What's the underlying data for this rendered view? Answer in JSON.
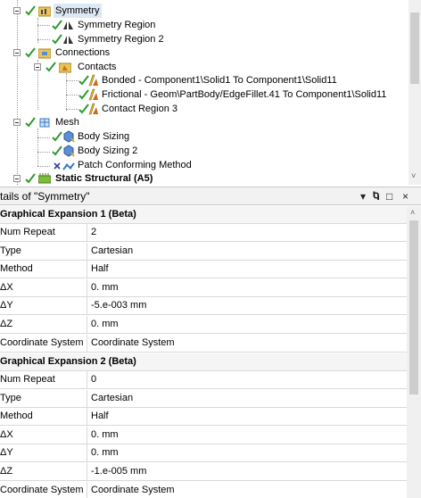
{
  "tree": {
    "items": [
      {
        "label": "Symmetry",
        "state": "highlight",
        "icon": "symmetry-folder-icon"
      },
      {
        "label": "Symmetry Region",
        "icon": "symmetry-region-icon"
      },
      {
        "label": "Symmetry Region 2",
        "icon": "symmetry-region-icon"
      },
      {
        "label": "Connections",
        "icon": "connections-icon"
      },
      {
        "label": "Contacts",
        "icon": "contacts-folder-icon"
      },
      {
        "label": "Bonded - Component1\\Solid1 To Component1\\Solid11",
        "icon": "contact-region-icon"
      },
      {
        "label": "Frictional - Geom\\PartBody/EdgeFillet.41 To Component1\\Solid11",
        "icon": "contact-region-icon"
      },
      {
        "label": "Contact Region 3",
        "icon": "contact-region-icon"
      },
      {
        "label": "Mesh",
        "icon": "mesh-icon"
      },
      {
        "label": "Body Sizing",
        "icon": "body-sizing-icon"
      },
      {
        "label": "Body Sizing 2",
        "icon": "body-sizing-icon"
      },
      {
        "label": "Patch Conforming Method",
        "icon": "patch-conforming-icon"
      },
      {
        "label": "Static Structural (A5)",
        "state": "bold",
        "icon": "static-structural-icon"
      }
    ]
  },
  "details": {
    "title": "tails of \"Symmetry\"",
    "controls": [
      "▾",
      "ᐅ",
      "□",
      "×"
    ]
  },
  "grid": {
    "rows": [
      {
        "type": "group",
        "label": "Graphical Expansion 1 (Beta)"
      },
      {
        "label": "Num Repeat",
        "value": "2"
      },
      {
        "label": "Type",
        "value": "Cartesian"
      },
      {
        "label": "Method",
        "value": "Half"
      },
      {
        "label": "ΔX",
        "value": "0. mm"
      },
      {
        "label": "ΔY",
        "value": "-5.e-003 mm"
      },
      {
        "label": "ΔZ",
        "value": "0. mm"
      },
      {
        "label": "Coordinate System",
        "value": "Coordinate System"
      },
      {
        "type": "group",
        "label": "Graphical Expansion 2 (Beta)"
      },
      {
        "label": "Num Repeat",
        "value": "0"
      },
      {
        "label": "Type",
        "value": "Cartesian"
      },
      {
        "label": "Method",
        "value": "Half"
      },
      {
        "label": "ΔX",
        "value": "0. mm"
      },
      {
        "label": "ΔY",
        "value": "0. mm"
      },
      {
        "label": "ΔZ",
        "value": "-1.e-005 mm"
      },
      {
        "label": "Coordinate System",
        "value": "Coordinate System"
      }
    ]
  },
  "colors": {
    "check_green": "#2e9a2e",
    "highlight": "#dde8f5",
    "contact_yellow": "#e1b63a",
    "mesh_blue": "#3a78c6"
  }
}
